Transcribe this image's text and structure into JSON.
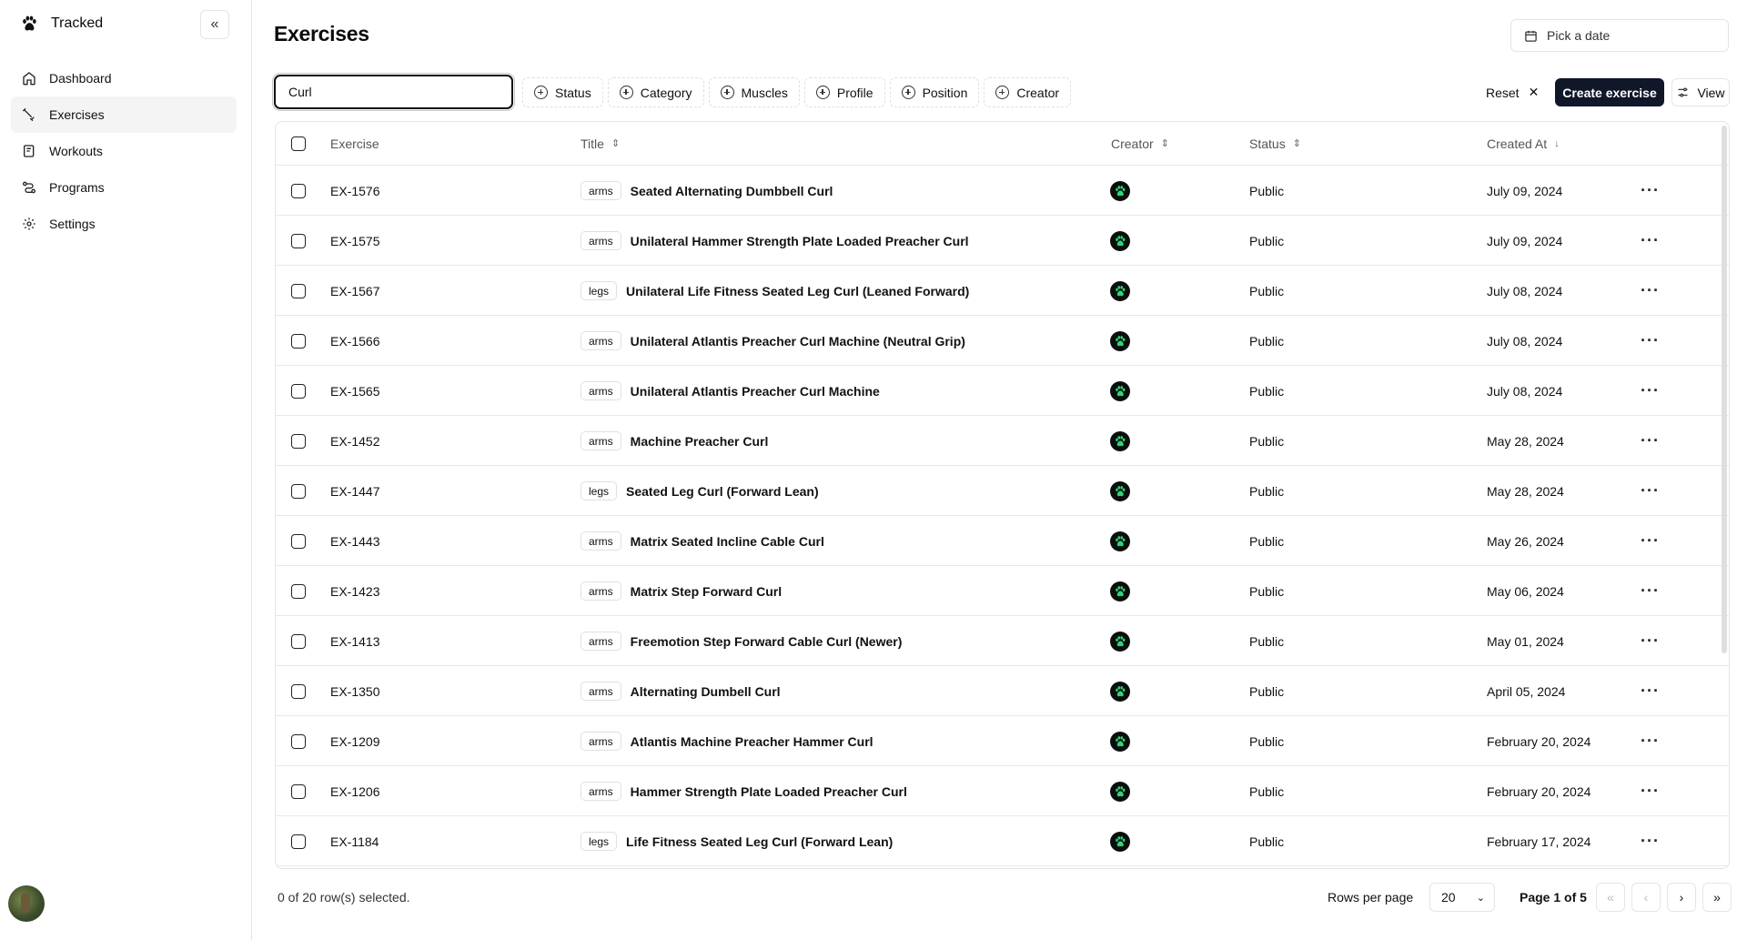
{
  "app": {
    "name": "Tracked",
    "logo_icon": "paw-icon"
  },
  "sidebar": {
    "collapse_icon": "double-chevron-left-icon",
    "items": [
      {
        "label": "Dashboard",
        "icon": "home-icon",
        "active": false
      },
      {
        "label": "Exercises",
        "icon": "exercise-icon",
        "active": true
      },
      {
        "label": "Workouts",
        "icon": "notebook-icon",
        "active": false
      },
      {
        "label": "Programs",
        "icon": "route-icon",
        "active": false
      },
      {
        "label": "Settings",
        "icon": "gear-icon",
        "active": false
      }
    ]
  },
  "page": {
    "title": "Exercises",
    "date_picker_placeholder": "Pick a date"
  },
  "toolbar": {
    "search_value": "Curl",
    "filters": [
      "Status",
      "Category",
      "Muscles",
      "Profile",
      "Position",
      "Creator"
    ],
    "reset_label": "Reset",
    "create_label": "Create exercise",
    "view_label": "View"
  },
  "table": {
    "columns": {
      "exercise": "Exercise",
      "title": "Title",
      "creator": "Creator",
      "status": "Status",
      "created_at": "Created At"
    },
    "rows": [
      {
        "id": "EX-1576",
        "category": "arms",
        "title": "Seated Alternating Dumbbell Curl",
        "status": "Public",
        "created_at": "July 09, 2024"
      },
      {
        "id": "EX-1575",
        "category": "arms",
        "title": "Unilateral Hammer Strength Plate Loaded Preacher Curl",
        "status": "Public",
        "created_at": "July 09, 2024"
      },
      {
        "id": "EX-1567",
        "category": "legs",
        "title": "Unilateral Life Fitness Seated Leg Curl (Leaned Forward)",
        "status": "Public",
        "created_at": "July 08, 2024"
      },
      {
        "id": "EX-1566",
        "category": "arms",
        "title": "Unilateral Atlantis Preacher Curl Machine (Neutral Grip)",
        "status": "Public",
        "created_at": "July 08, 2024"
      },
      {
        "id": "EX-1565",
        "category": "arms",
        "title": "Unilateral Atlantis Preacher Curl Machine",
        "status": "Public",
        "created_at": "July 08, 2024"
      },
      {
        "id": "EX-1452",
        "category": "arms",
        "title": "Machine Preacher Curl",
        "status": "Public",
        "created_at": "May 28, 2024"
      },
      {
        "id": "EX-1447",
        "category": "legs",
        "title": "Seated Leg Curl (Forward Lean)",
        "status": "Public",
        "created_at": "May 28, 2024"
      },
      {
        "id": "EX-1443",
        "category": "arms",
        "title": "Matrix Seated Incline Cable Curl",
        "status": "Public",
        "created_at": "May 26, 2024"
      },
      {
        "id": "EX-1423",
        "category": "arms",
        "title": "Matrix Step Forward Curl",
        "status": "Public",
        "created_at": "May 06, 2024"
      },
      {
        "id": "EX-1413",
        "category": "arms",
        "title": "Freemotion Step Forward Cable Curl (Newer)",
        "status": "Public",
        "created_at": "May 01, 2024"
      },
      {
        "id": "EX-1350",
        "category": "arms",
        "title": "Alternating Dumbell Curl",
        "status": "Public",
        "created_at": "April 05, 2024"
      },
      {
        "id": "EX-1209",
        "category": "arms",
        "title": "Atlantis Machine Preacher Hammer Curl",
        "status": "Public",
        "created_at": "February 20, 2024"
      },
      {
        "id": "EX-1206",
        "category": "arms",
        "title": "Hammer Strength Plate Loaded Preacher Curl",
        "status": "Public",
        "created_at": "February 20, 2024"
      },
      {
        "id": "EX-1184",
        "category": "legs",
        "title": "Life Fitness Seated Leg Curl (Forward Lean)",
        "status": "Public",
        "created_at": "February 17, 2024"
      }
    ]
  },
  "footer": {
    "selected_info": "0 of 20 row(s) selected.",
    "rows_per_page_label": "Rows per page",
    "rows_per_page_value": "20",
    "page_label": "Page 1 of 5"
  },
  "colors": {
    "primary": "#0f1729",
    "creator_badge_bg": "#0b0f0c",
    "creator_badge_paw": "#2fd47b"
  }
}
